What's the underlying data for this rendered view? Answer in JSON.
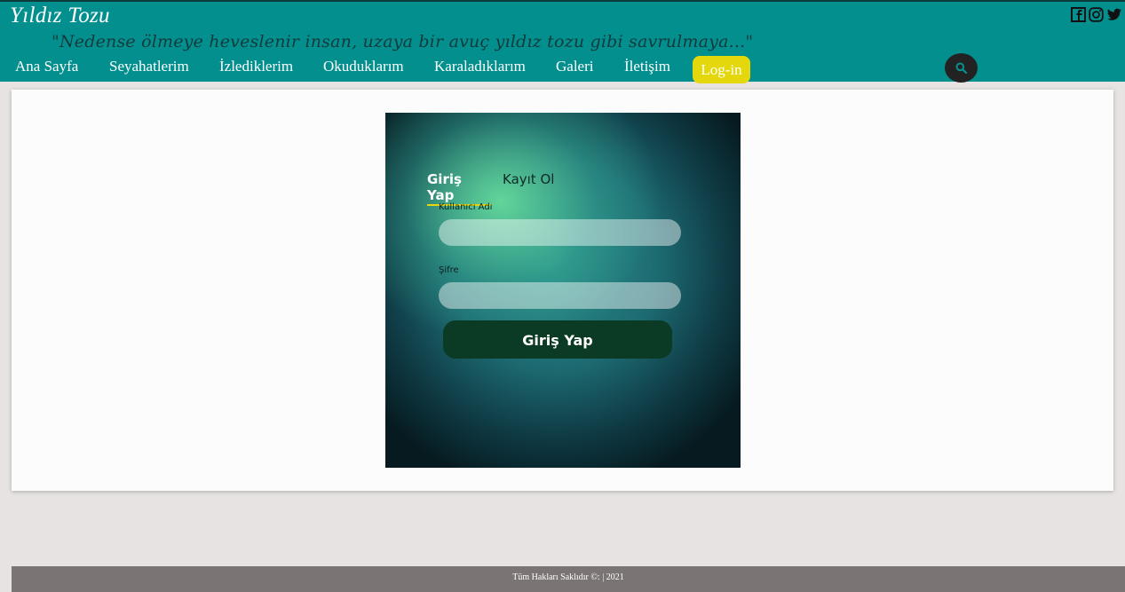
{
  "site": {
    "title": "Yıldız Tozu",
    "tagline": "\"Nedense ölmeye heveslenir insan, uzaya bir avuç yıldız tozu gibi savrulmaya...\""
  },
  "social": [
    "facebook-icon",
    "instagram-icon",
    "twitter-icon"
  ],
  "nav": {
    "items": [
      {
        "label": "Ana Sayfa"
      },
      {
        "label": "Seyahatlerim"
      },
      {
        "label": "İzlediklerim"
      },
      {
        "label": "Okuduklarım"
      },
      {
        "label": "Karaladıklarım"
      },
      {
        "label": "Galeri"
      },
      {
        "label": "İletişim"
      }
    ],
    "login_label": "Log-in",
    "search_icon": "search-icon"
  },
  "login": {
    "tab_login": "Giriş Yap",
    "tab_register": "Kayıt Ol",
    "username_label": "Kullanıcı Adı",
    "username_value": "",
    "password_label": "Şifre",
    "password_value": "",
    "submit_label": "Giriş Yap"
  },
  "footer": {
    "text": "Tüm Hakları Saklıdır ©: | 2021"
  },
  "colors": {
    "header_bg": "#048f8f",
    "login_highlight": "#e4d80c",
    "submit_bg": "#0b3b24",
    "footer_bg": "#7b7474"
  }
}
